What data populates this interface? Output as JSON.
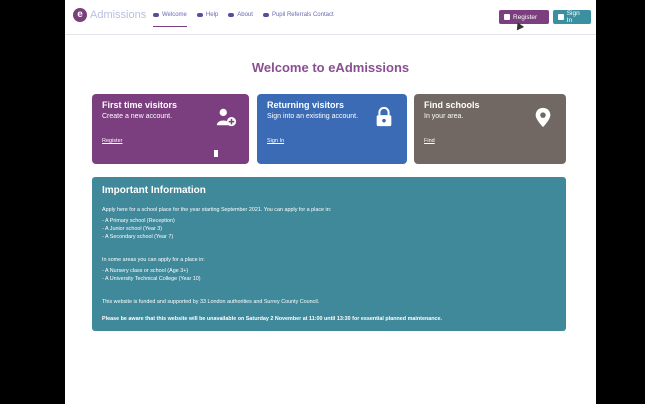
{
  "brand": {
    "logo_letter": "e",
    "logo_text": "Admissions"
  },
  "nav": {
    "items": [
      {
        "label": "Welcome"
      },
      {
        "label": "Help"
      },
      {
        "label": "About"
      },
      {
        "label": "Pupil Referrals Contact"
      }
    ],
    "register": "Register",
    "signin": "Sign In"
  },
  "page_title": "Welcome to eAdmissions",
  "cards": [
    {
      "title": "First time visitors",
      "desc": "Create a new account.",
      "link": "Register"
    },
    {
      "title": "Returning visitors",
      "desc": "Sign into an existing account.",
      "link": "Sign In"
    },
    {
      "title": "Find schools",
      "desc": "In your area.",
      "link": "Find"
    }
  ],
  "info": {
    "title": "Important Information",
    "lines": [
      "Apply here for a school place for the year starting September 2021. You can apply for a place in:",
      " - A Primary school (Reception)",
      " - A Junior school (Year 3)",
      " - A Secondary school (Year 7)",
      "In some areas you can apply for a place in:",
      " - A Nursery class or school (Age 3+)",
      " - A University Technical College (Year 10)",
      "This website is funded and supported by 33 London authorities and Surrey County Council.",
      "Please be aware that this website will be unavailable on Saturday 2 November at 11:00 until 13:30 for essential planned maintenance."
    ]
  },
  "colors": {
    "primary": "#7b3e7e",
    "card_returning": "#3b6bb4",
    "card_find": "#716863",
    "info": "#40899b"
  }
}
